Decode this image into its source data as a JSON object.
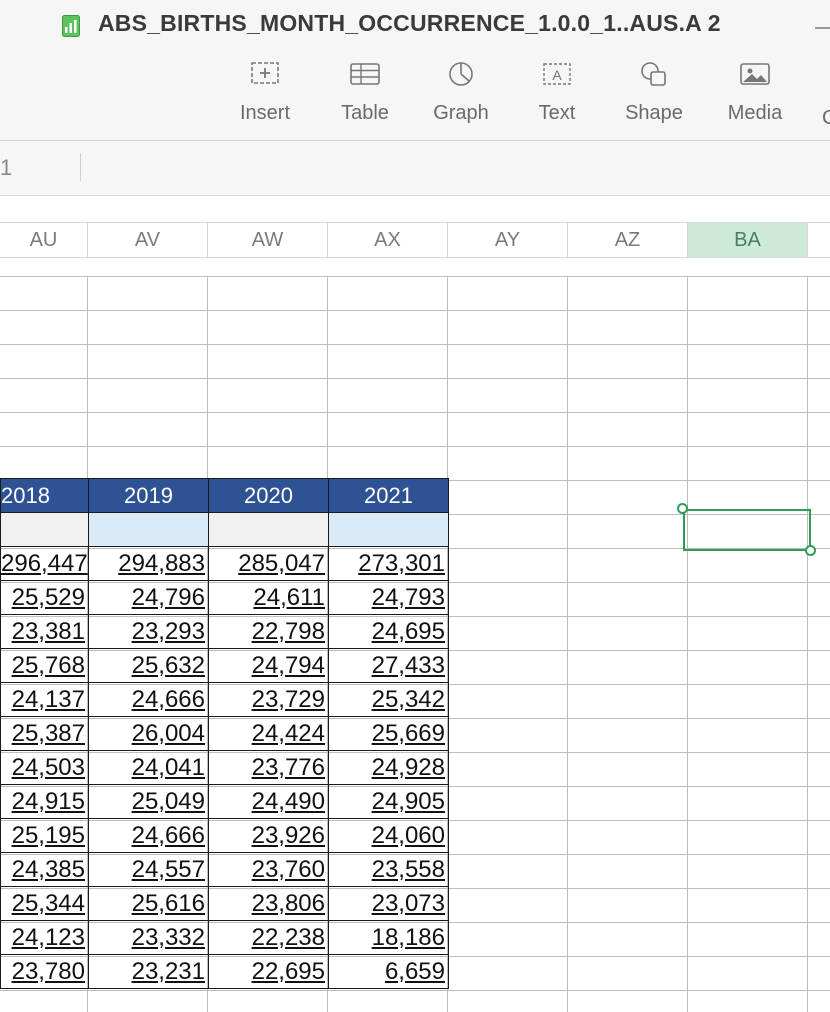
{
  "window": {
    "title": "ABS_BIRTHS_MONTH_OCCURRENCE_1.0.0_1..AUS.A 2"
  },
  "toolbar": {
    "items": [
      {
        "label": "Insert",
        "icon": "insert-icon"
      },
      {
        "label": "Table",
        "icon": "table-icon"
      },
      {
        "label": "Graph",
        "icon": "graph-icon"
      },
      {
        "label": "Text",
        "icon": "text-box-icon"
      },
      {
        "label": "Shape",
        "icon": "shape-icon"
      },
      {
        "label": "Media",
        "icon": "media-icon"
      }
    ],
    "cut_label": "C"
  },
  "formula_bar": {
    "cell_ref": "1"
  },
  "columns": [
    "AU",
    "AV",
    "AW",
    "AX",
    "AY",
    "AZ",
    "BA"
  ],
  "selected_column": "BA",
  "table": {
    "headers": [
      "2018",
      "2019",
      "2020",
      "2021"
    ],
    "rows": [
      [
        "296,447",
        "294,883",
        "285,047",
        "273,301"
      ],
      [
        "25,529",
        "24,796",
        "24,611",
        "24,793"
      ],
      [
        "23,381",
        "23,293",
        "22,798",
        "24,695"
      ],
      [
        "25,768",
        "25,632",
        "24,794",
        "27,433"
      ],
      [
        "24,137",
        "24,666",
        "23,729",
        "25,342"
      ],
      [
        "25,387",
        "26,004",
        "24,424",
        "25,669"
      ],
      [
        "24,503",
        "24,041",
        "23,776",
        "24,928"
      ],
      [
        "24,915",
        "25,049",
        "24,490",
        "24,905"
      ],
      [
        "25,195",
        "24,666",
        "23,926",
        "24,060"
      ],
      [
        "24,385",
        "24,557",
        "23,760",
        "23,558"
      ],
      [
        "25,344",
        "25,616",
        "23,806",
        "23,073"
      ],
      [
        "24,123",
        "23,332",
        "22,238",
        "18,186"
      ],
      [
        "23,780",
        "23,231",
        "22,695",
        "6,659"
      ]
    ]
  },
  "colors": {
    "header_fill": "#2e5395",
    "selection": "#2e9e57",
    "selected_column_fill": "#cde9d9"
  }
}
